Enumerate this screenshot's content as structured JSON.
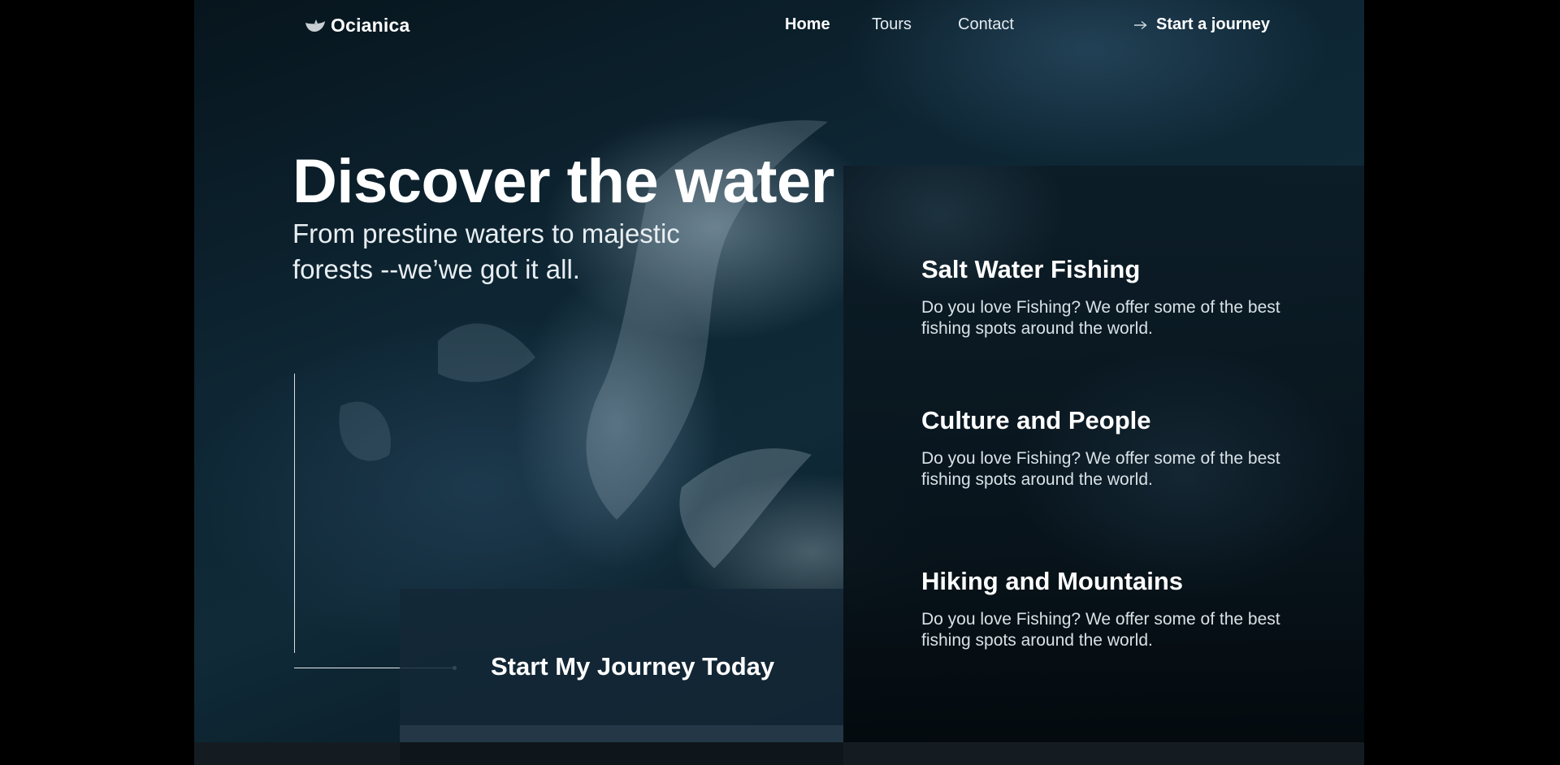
{
  "brand": {
    "name": "Ocianica",
    "icon": "boat-icon"
  },
  "nav": {
    "links": [
      {
        "label": "Home",
        "active": true
      },
      {
        "label": "Tours",
        "active": false
      },
      {
        "label": "Contact",
        "active": false
      }
    ],
    "cta": {
      "label": "Start a journey",
      "icon": "arrow-right-icon"
    }
  },
  "hero": {
    "title": "Discover the water",
    "subtitle": "From prestine waters to majestic forests --we’we got it all."
  },
  "journey_cta": {
    "label": "Start My Journey Today"
  },
  "features": [
    {
      "title": "Salt Water Fishing",
      "description": "Do you love Fishing? We offer some of the best fishing spots around the world."
    },
    {
      "title": "Culture and People",
      "description": "Do you love Fishing? We offer some of the best fishing spots around the world."
    },
    {
      "title": "Hiking and Mountains",
      "description": "Do you love Fishing? We offer some of the best fishing spots around the world."
    }
  ],
  "colors": {
    "background": "#000000",
    "panel": "#0c1c26",
    "cta_box": "#142837",
    "text": "#ffffff"
  }
}
